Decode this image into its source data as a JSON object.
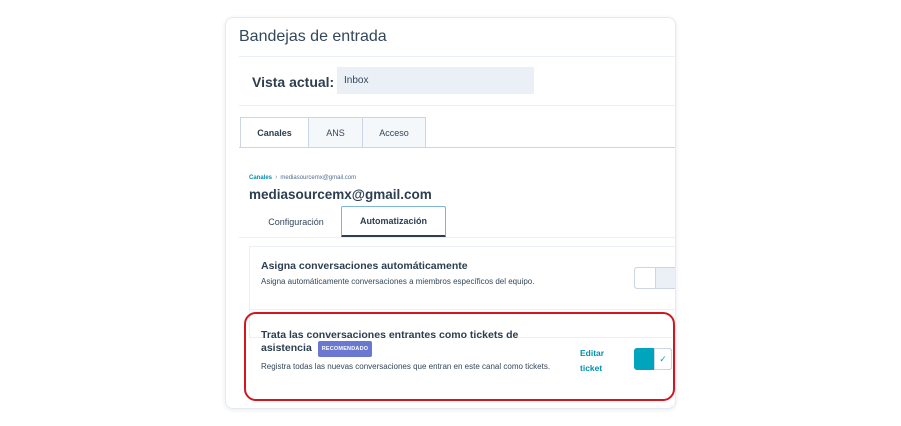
{
  "header": {
    "title": "Bandejas de entrada"
  },
  "view": {
    "label": "Vista actual:",
    "value": "Inbox"
  },
  "tabs": [
    {
      "label": "Canales",
      "active": true
    },
    {
      "label": "ANS",
      "active": false
    },
    {
      "label": "Acceso",
      "active": false
    }
  ],
  "breadcrumb": {
    "root": "Canales",
    "separator": "›",
    "current": "mediasourcemx@gmail.com"
  },
  "channel": {
    "title": "mediasourcemx@gmail.com"
  },
  "subtabs": [
    {
      "label": "Configuración",
      "active": false
    },
    {
      "label": "Automatización",
      "active": true
    }
  ],
  "settings": {
    "auto_assign": {
      "title": "Asigna conversaciones automáticamente",
      "description": "Asigna automáticamente conversaciones a miembros específicos del equipo.",
      "enabled": false
    },
    "tickets": {
      "title": "Trata las conversaciones entrantes como tickets de asistencia",
      "badge": "RECOMENDADO",
      "description": "Registra todas las nuevas conversaciones que entran en este canal como tickets.",
      "edit_label": "Editar ticket",
      "enabled": true,
      "check_icon": "✓"
    }
  },
  "colors": {
    "accent": "#00a4bd",
    "link": "#0091ae",
    "badge": "#6a78d1",
    "highlight": "#d3161f",
    "text_dark": "#2d3e50"
  }
}
